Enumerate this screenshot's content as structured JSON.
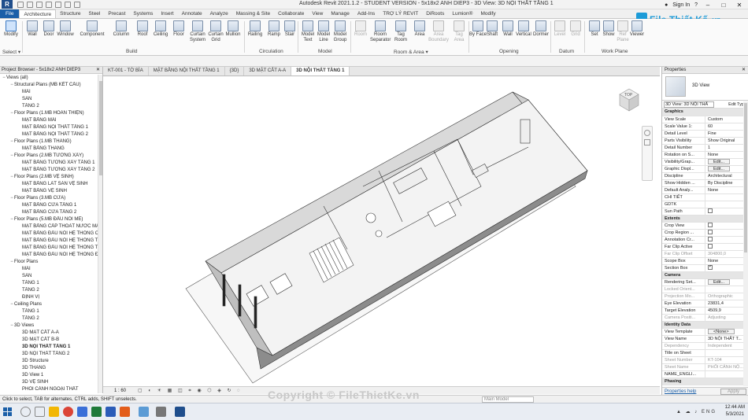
{
  "titlebar": {
    "app_letter": "R",
    "title": "Autodesk Revit 2021.1.2 - STUDENT VERSION - 5x18x2 ANH DIEP3 - 3D View: 3D NỘI THẤT TẦNG 1",
    "sign_in": "Sign In",
    "help": "?"
  },
  "ribbon_tabs": [
    "File",
    "Architecture",
    "Structure",
    "Steel",
    "Precast",
    "Systems",
    "Insert",
    "Annotate",
    "Analyze",
    "Massing & Site",
    "Collaborate",
    "View",
    "Manage",
    "Add-Ins",
    "TRỢ LÝ REVIT",
    "DiRoots",
    "Lumion®",
    "Modify"
  ],
  "ribbon_active_tab": "Architecture",
  "ribbon": {
    "modify": "Modify",
    "select": "Select ▾",
    "buttons": [
      {
        "label": "Wall"
      },
      {
        "label": "Door"
      },
      {
        "label": "Window"
      },
      {
        "label": "Component"
      },
      {
        "label": "Column"
      },
      {
        "label": "Roof"
      },
      {
        "label": "Ceiling"
      },
      {
        "label": "Floor"
      },
      {
        "label": "Curtain System"
      },
      {
        "label": "Curtain Grid"
      },
      {
        "label": "Mullion"
      },
      {
        "label": "Railing"
      },
      {
        "label": "Ramp"
      },
      {
        "label": "Stair"
      },
      {
        "label": "Model Text"
      },
      {
        "label": "Model Line"
      },
      {
        "label": "Model Group"
      },
      {
        "label": "Room"
      },
      {
        "label": "Room Separator"
      },
      {
        "label": "Tag Room"
      },
      {
        "label": "Area"
      },
      {
        "label": "Area Boundary"
      },
      {
        "label": "Tag Area"
      },
      {
        "label": "By Face"
      },
      {
        "label": "Shaft"
      },
      {
        "label": "Wall"
      },
      {
        "label": "Vertical"
      },
      {
        "label": "Dormer"
      },
      {
        "label": "Level"
      },
      {
        "label": "Grid"
      },
      {
        "label": "Set"
      },
      {
        "label": "Show"
      },
      {
        "label": "Ref Plane"
      },
      {
        "label": "Viewer"
      }
    ],
    "groups": [
      "Build",
      "Circulation",
      "Model",
      "Room & Area ▾",
      "Opening",
      "Datum",
      "Work Plane"
    ]
  },
  "logo": {
    "text": "File Thiết Kế",
    "suffix": ".vn"
  },
  "project_browser": {
    "title": "Project Browser - 5x18x2 ANH DIEP3",
    "items": [
      {
        "label": "Views (all)",
        "toggle": "−",
        "level": 0
      },
      {
        "label": "Structural Plans (MB KẾT CẤU)",
        "toggle": "−",
        "level": 1
      },
      {
        "label": "MÁI",
        "toggle": "",
        "level": 2
      },
      {
        "label": "SÀN",
        "toggle": "",
        "level": 2
      },
      {
        "label": "TẦNG 2",
        "toggle": "",
        "level": 2
      },
      {
        "label": "Floor Plans (1.MB HOÀN THIỆN)",
        "toggle": "−",
        "level": 1
      },
      {
        "label": "MẶT BẰNG MÁI",
        "toggle": "",
        "level": 2
      },
      {
        "label": "MẶT BẰNG NỘI THẤT TẦNG 1",
        "toggle": "",
        "level": 2
      },
      {
        "label": "MẶT BẰNG NỘI THẤT TẦNG 2",
        "toggle": "",
        "level": 2
      },
      {
        "label": "Floor Plans (1.MB THANG)",
        "toggle": "−",
        "level": 1
      },
      {
        "label": "MẶT BẰNG THANG",
        "toggle": "",
        "level": 2
      },
      {
        "label": "Floor Plans (2.MB TƯỜNG XÂY)",
        "toggle": "−",
        "level": 1
      },
      {
        "label": "MẶT BẰNG TƯỜNG XÂY TẦNG 1",
        "toggle": "",
        "level": 2
      },
      {
        "label": "MẶT BẰNG TƯỜNG XÂY TẦNG 2",
        "toggle": "",
        "level": 2
      },
      {
        "label": "Floor Plans (2.MB VỆ SINH)",
        "toggle": "−",
        "level": 1
      },
      {
        "label": "MẶT BẰNG LÁT SÀN VỆ SINH",
        "toggle": "",
        "level": 2
      },
      {
        "label": "MẶT BẰNG VỆ SINH",
        "toggle": "",
        "level": 2
      },
      {
        "label": "Floor Plans (3.MB CỬA)",
        "toggle": "−",
        "level": 1
      },
      {
        "label": "MẶT BẰNG CỬA TẦNG 1",
        "toggle": "",
        "level": 2
      },
      {
        "label": "MẶT BẰNG CỬA TẦNG 2",
        "toggle": "",
        "level": 2
      },
      {
        "label": "Floor Plans (5.MB ĐẦU NỐI ME)",
        "toggle": "−",
        "level": 1
      },
      {
        "label": "MẶT BẰNG CẤP THOÁT NƯỚC MÁ",
        "toggle": "",
        "level": 2
      },
      {
        "label": "MẶT BẰNG ĐẦU NỐI HỆ THỐNG C",
        "toggle": "",
        "level": 2
      },
      {
        "label": "MẶT BẰNG ĐẦU NỐI HỆ THỐNG T",
        "toggle": "",
        "level": 2
      },
      {
        "label": "MẶT BẰNG ĐẦU NỐI HỆ THỐNG T",
        "toggle": "",
        "level": 2
      },
      {
        "label": "MẶT BẰNG ĐẦU NỐI HỆ THỐNG Đ",
        "toggle": "",
        "level": 2
      },
      {
        "label": "Floor Plans",
        "toggle": "−",
        "level": 1
      },
      {
        "label": "MÁI",
        "toggle": "",
        "level": 2
      },
      {
        "label": "SÀN",
        "toggle": "",
        "level": 2
      },
      {
        "label": "TẦNG 1",
        "toggle": "",
        "level": 2
      },
      {
        "label": "TẦNG 2",
        "toggle": "",
        "level": 2
      },
      {
        "label": "ĐỊNH VỊ",
        "toggle": "",
        "level": 2
      },
      {
        "label": "Ceiling Plans",
        "toggle": "−",
        "level": 1
      },
      {
        "label": "TẦNG 1",
        "toggle": "",
        "level": 2
      },
      {
        "label": "TẦNG 2",
        "toggle": "",
        "level": 2
      },
      {
        "label": "3D Views",
        "toggle": "−",
        "level": 1
      },
      {
        "label": "3D MẶT CẮT A-A",
        "toggle": "",
        "level": 2
      },
      {
        "label": "3D MẶT CẮT B-B",
        "toggle": "",
        "level": 2
      },
      {
        "label": "3D NỘI THẤT TẦNG 1",
        "toggle": "",
        "level": 2,
        "selected": true
      },
      {
        "label": "3D NỘI THẤT TẦNG 2",
        "toggle": "",
        "level": 2
      },
      {
        "label": "3D Structure",
        "toggle": "",
        "level": 2
      },
      {
        "label": "3D THANG",
        "toggle": "",
        "level": 2
      },
      {
        "label": "3D View 1",
        "toggle": "",
        "level": 2
      },
      {
        "label": "3D VỆ SINH",
        "toggle": "",
        "level": 2
      },
      {
        "label": "PHỐI CẢNH NGOẠI THẤT",
        "toggle": "",
        "level": 2
      }
    ]
  },
  "view_tabs": [
    {
      "label": "KT-001 - TỜ BÌA",
      "active": false
    },
    {
      "label": "MẶT BẰNG NỘI THẤT TẦNG 1",
      "active": false
    },
    {
      "label": "{3D}",
      "active": false
    },
    {
      "label": "3D MẶT CẮT A-A",
      "active": false
    },
    {
      "label": "3D NỘI THẤT TẦNG 1",
      "active": true
    }
  ],
  "viewcube": {
    "label": "TOP"
  },
  "view_control": {
    "scale": "1 : 60"
  },
  "properties": {
    "title": "Properties",
    "type_name": "3D View",
    "instance": "3D View: 3D NỘI THẤ",
    "edit_type": "Edit Type",
    "sections": [
      {
        "name": "Graphics",
        "rows": [
          [
            "View Scale",
            "Custom"
          ],
          [
            "Scale Value   1:",
            "60"
          ],
          [
            "Detail Level",
            "Fine"
          ],
          [
            "Parts Visibility",
            "Show Original"
          ],
          [
            "Detail Number",
            "1"
          ],
          [
            "Rotation on S...",
            "None"
          ],
          [
            "Visibility/Grap...",
            "Edit...",
            "button"
          ],
          [
            "Graphic Displ...",
            "Edit...",
            "button"
          ],
          [
            "Discipline",
            "Architectural"
          ],
          [
            "Show Hidden ...",
            "By Discipline"
          ],
          [
            "Default Analy...",
            "None"
          ],
          [
            "CHI TIẾT",
            ""
          ],
          [
            "GDTK",
            ""
          ],
          [
            "Sun Path",
            "",
            "check"
          ]
        ]
      },
      {
        "name": "Extents",
        "rows": [
          [
            "Crop View",
            "",
            "check"
          ],
          [
            "Crop Region ...",
            "",
            "check"
          ],
          [
            "Annotation Cr...",
            "",
            "check"
          ],
          [
            "Far Clip Active",
            "",
            "check"
          ],
          [
            "Far Clip Offset",
            "304800,0",
            "disabled"
          ],
          [
            "Scope Box",
            "None"
          ],
          [
            "Section Box",
            "",
            "checked"
          ]
        ]
      },
      {
        "name": "Camera",
        "rows": [
          [
            "Rendering Set...",
            "Edit...",
            "button"
          ],
          [
            "Locked Orient...",
            "",
            "disabled"
          ],
          [
            "Projection Mo...",
            "Orthographic",
            "disabled"
          ],
          [
            "Eye Elevation",
            "23831,4"
          ],
          [
            "Target Elevation",
            "4509,9"
          ],
          [
            "Camera Positi...",
            "Adjusting",
            "disabled"
          ]
        ]
      },
      {
        "name": "Identity Data",
        "rows": [
          [
            "View Template",
            "<None>",
            "button"
          ],
          [
            "View Name",
            "3D NỘI THẤT T..."
          ],
          [
            "Dependency",
            "Independent",
            "disabled"
          ],
          [
            "Title on Sheet",
            ""
          ],
          [
            "Sheet Number",
            "KT-104",
            "disabled"
          ],
          [
            "Sheet Name",
            "PHỐI CẢNH NỘ...",
            "disabled"
          ],
          [
            "NAME_ENGLI...",
            ""
          ]
        ]
      },
      {
        "name": "Phasing",
        "rows": []
      }
    ],
    "help_link": "Properties help",
    "apply": "Apply"
  },
  "status": {
    "message": "Click to select, TAB for alternates, CTRL adds, SHIFT unselects.",
    "model": "Main Model",
    "watermark": "Copyright © FileThietKe.vn"
  },
  "taskbar": {
    "time": "12:44 AM",
    "date": "5/3/2021",
    "lang": "ENG"
  },
  "colors": {
    "file_tab": "#1b5fa8",
    "logo": "#1d9bd8"
  }
}
